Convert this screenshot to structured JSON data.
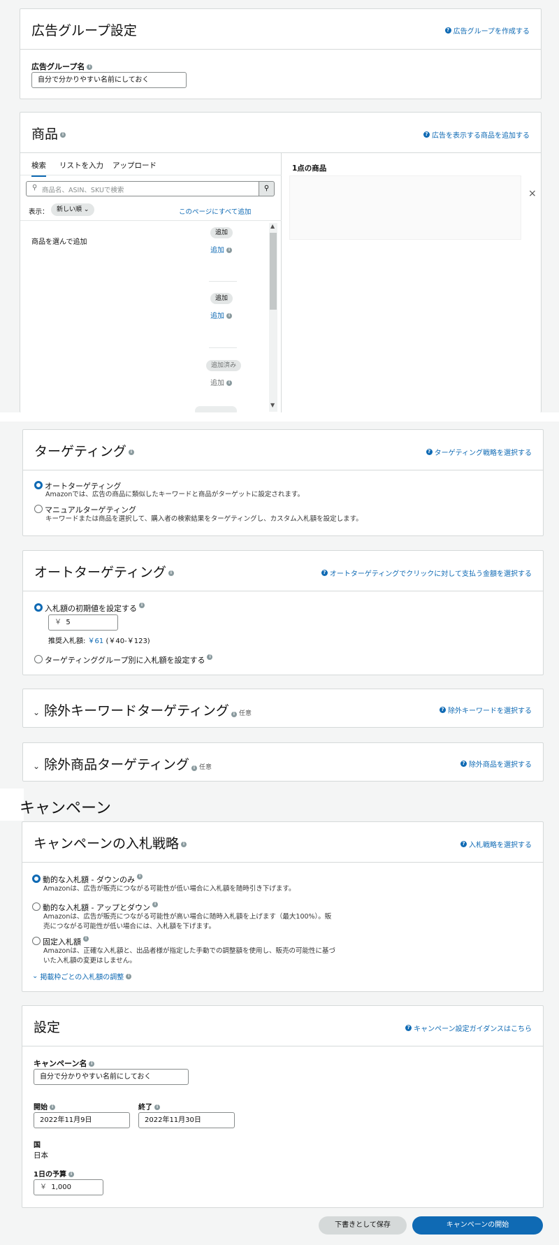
{
  "ad_group": {
    "title": "広告グループ設定",
    "help_link": "広告グループを作成する",
    "name_label": "広告グループ名",
    "name_value": "自分で分かりやすい名前にしておく"
  },
  "products": {
    "title": "商品",
    "help_link": "広告を表示する商品を追加する",
    "tabs": [
      "検索",
      "リストを入力",
      "アップロード"
    ],
    "search_placeholder": "商品名、ASIN、SKUで検索",
    "display_label": "表示：",
    "sort_value": "新しい順",
    "add_all_link": "このページにすべて追加",
    "pick_label": "商品を選んで追加",
    "rows": [
      {
        "button": "追加",
        "link": "追加"
      },
      {
        "button": "追加",
        "link": "追加"
      },
      {
        "button": "追加済み",
        "link": "追加"
      }
    ],
    "selected_count": "1点の商品"
  },
  "targeting": {
    "title": "ターゲティング",
    "help_link": "ターゲティング戦略を選択する",
    "options": [
      {
        "label": "オートターゲティング",
        "desc": "Amazonでは、広告の商品に類似したキーワードと商品がターゲットに設定されます。"
      },
      {
        "label": "マニュアルターゲティング",
        "desc": "キーワードまたは商品を選択して、購入者の検索結果をターゲティングし、カスタム入札額を設定します。"
      }
    ]
  },
  "auto_targeting": {
    "title": "オートターゲティング",
    "help_link": "オートターゲティングでクリックに対して支払う金額を選択する",
    "opt_default": "入札額の初期値を設定する",
    "currency": "￥",
    "bid_value": "5",
    "suggest_label": "推奨入札額:",
    "suggest_value": "￥61",
    "suggest_range": "(￥40-￥123)",
    "opt_group": "ターゲティンググループ別に入札額を設定する"
  },
  "neg_keyword": {
    "title": "除外キーワードターゲティング",
    "optional": "任意",
    "help_link": "除外キーワードを選択する"
  },
  "neg_product": {
    "title": "除外商品ターゲティング",
    "optional": "任意",
    "help_link": "除外商品を選択する"
  },
  "campaign_heading": "キャンペーン",
  "bid_strategy": {
    "title": "キャンペーンの入札戦略",
    "help_link": "入札戦略を選択する",
    "options": [
      {
        "label": "動的な入札額 - ダウンのみ",
        "desc1": "Amazonは、広告が販売につながる可能性が低い場合に入札額を随時引き下げます。",
        "desc2": ""
      },
      {
        "label": "動的な入札額 - アップとダウン",
        "desc1": "Amazonは、広告が販売につながる可能性が高い場合に随時入札額を上げます（最大100%）。販",
        "desc2": "売につながる可能性が低い場合には、入札額を下げます。"
      },
      {
        "label": "固定入札額",
        "desc1": "Amazonは、正確な入札額と、出品者様が指定した手動での調整額を使用し、販売の可能性に基づ",
        "desc2": "いた入札額の変更はしません。"
      }
    ],
    "placement_link": "掲載枠ごとの入札額の調整"
  },
  "settings": {
    "title": "設定",
    "help_link": "キャンペーン設定ガイダンスはこちら",
    "campaign_name_label": "キャンペーン名",
    "campaign_name_value": "自分で分かりやすい名前にしておく",
    "start_label": "開始",
    "start_value": "2022年11月9日",
    "end_label": "終了",
    "end_value": "2022年11月30日",
    "country_label": "国",
    "country_value": "日本",
    "budget_label": "1日の予算",
    "budget_currency": "￥",
    "budget_value": "1,000"
  },
  "footer": {
    "save_draft": "下書きとして保存",
    "launch": "キャンペーンの開始"
  }
}
